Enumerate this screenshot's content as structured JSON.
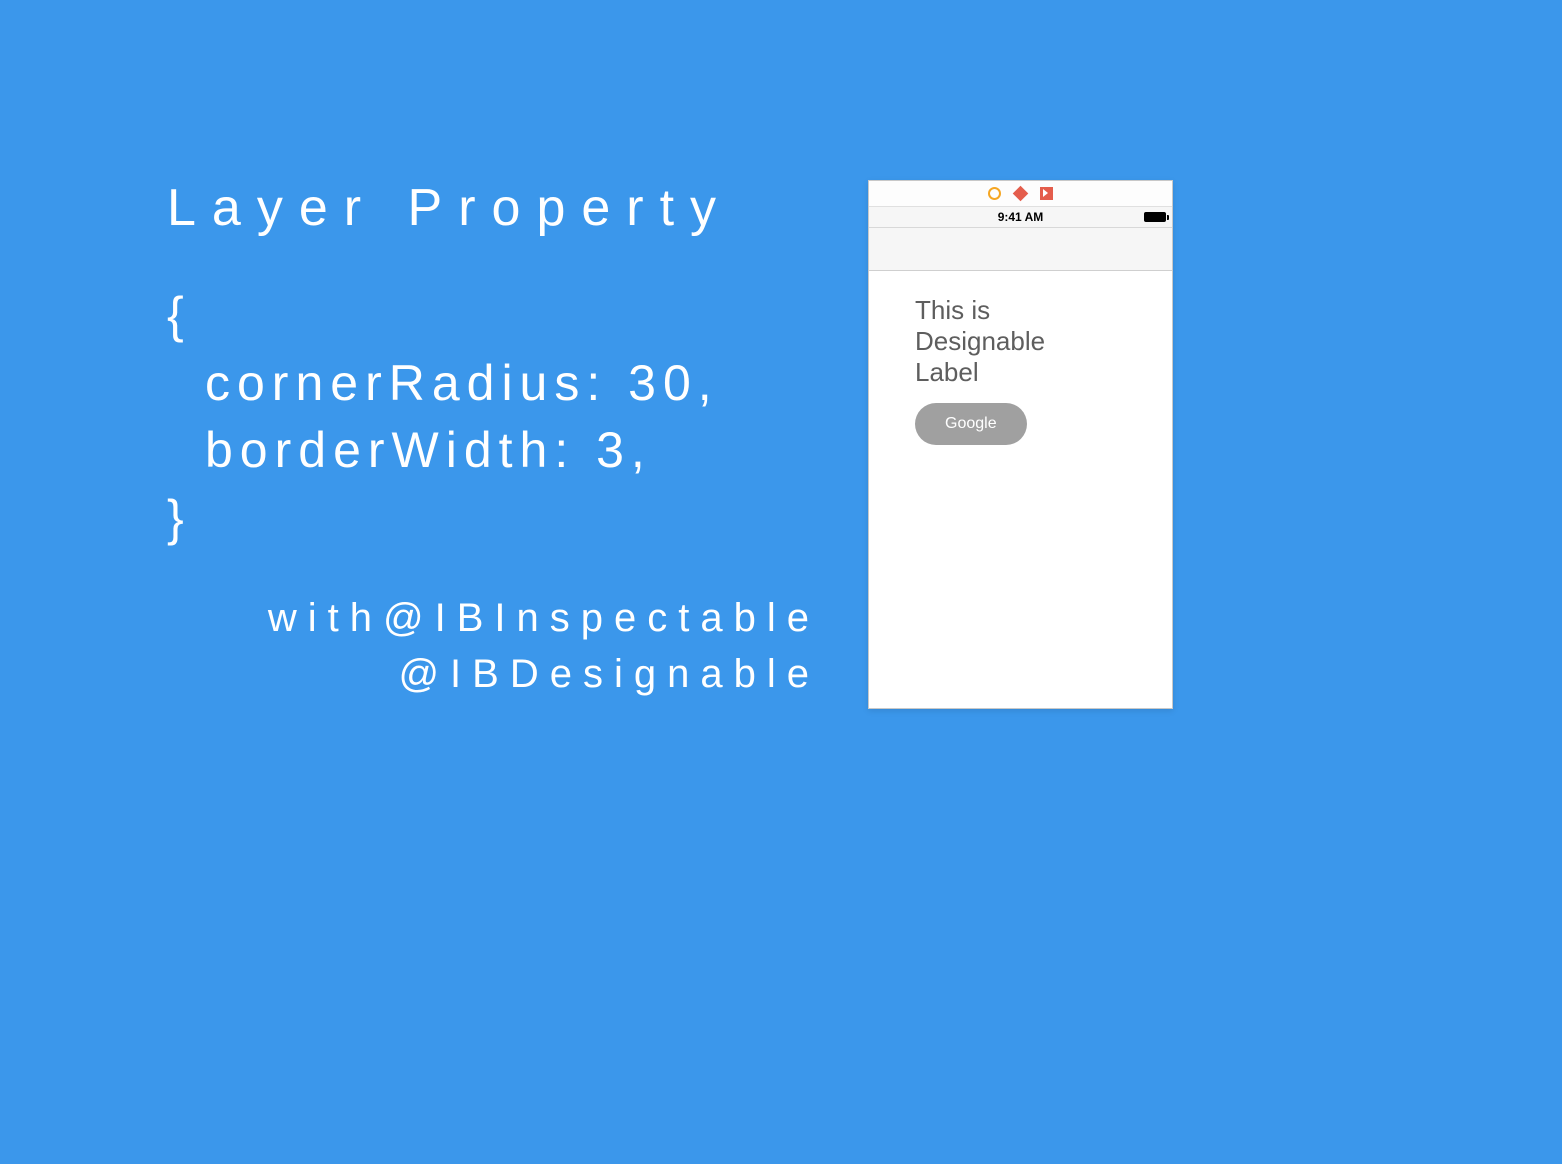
{
  "title": "Layer Property",
  "code": {
    "open": "{",
    "line1": "cornerRadius: 30,",
    "line2": "borderWidth: 3,",
    "close": "}"
  },
  "subtitle": {
    "line1": "with@IBInspectable",
    "line2": "@IBDesignable"
  },
  "phone": {
    "status_time": "9:41 AM",
    "label_text": "This is Designable Label",
    "button_label": "Google"
  }
}
